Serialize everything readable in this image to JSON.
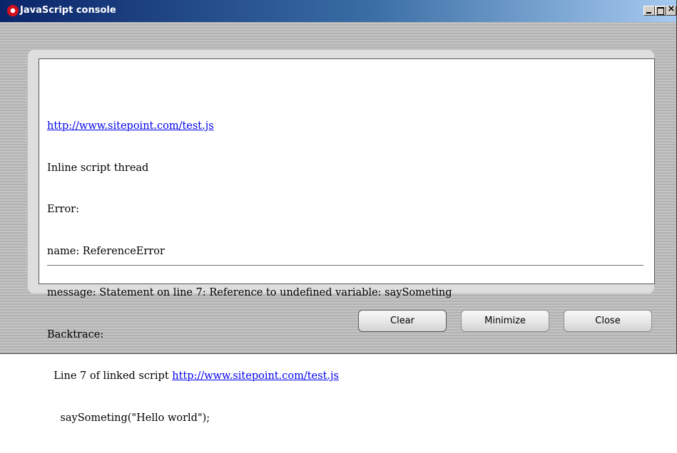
{
  "window": {
    "title": "JavaScript console",
    "controls": {
      "minimize": "minimize-window",
      "maximize": "maximize-window",
      "close": "close-window"
    }
  },
  "console": {
    "link_url": "http://www.sitepoint.com/test.js",
    "thread": "Inline script thread",
    "error_label": "Error:",
    "name_line": "name: ReferenceError",
    "message_line": "message: Statement on line 7: Reference to undefined variable: saySometing",
    "backtrace_label": "Backtrace:",
    "backtrace_prefix": "  Line 7 of linked script ",
    "backtrace_url": "http://www.sitepoint.com/test.js",
    "code_line": "    saySometing(\"Hello world\");"
  },
  "buttons": {
    "clear": "Clear",
    "minimize": "Minimize",
    "close": "Close"
  },
  "colors": {
    "title_gradient_start": "#0a246a",
    "title_gradient_end": "#a6caf0",
    "link": "#0000ee"
  }
}
